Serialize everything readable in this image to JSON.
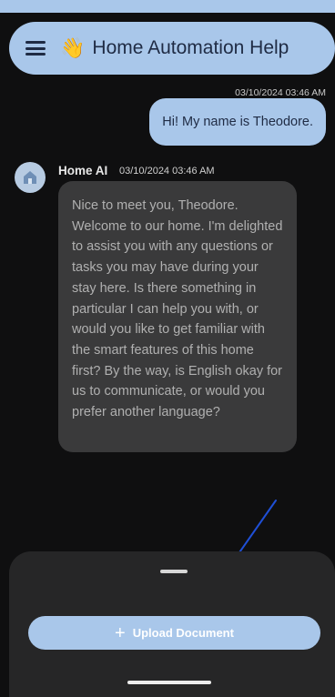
{
  "header": {
    "title": "Home Automation Help",
    "wave_emoji": "👋",
    "menu_icon": "hamburger-menu-icon"
  },
  "messages": {
    "user": {
      "timestamp": "03/10/2024 03:46 AM",
      "text": "Hi! My name is Theodore."
    },
    "bot": {
      "name": "Home AI",
      "timestamp": "03/10/2024 03:46 AM",
      "avatar_icon": "home-icon",
      "text": "Nice to meet you, Theodore. Welcome to our home. I'm delighted to assist you with any questions or tasks you may have during your stay here. Is there something in particular I can help you with, or would you like to get familiar with the smart features of this home first? By the way, is English okay for us to communicate, or would you prefer another language?"
    }
  },
  "bottom_sheet": {
    "upload_button_label": "Upload Document",
    "upload_icon": "plus-icon"
  },
  "colors": {
    "accent": "#a9c7ea",
    "background": "#0f0f10",
    "bot_bubble": "#3a3a3b",
    "sheet": "#262627",
    "annotation_arrow": "#1f4fd6"
  }
}
